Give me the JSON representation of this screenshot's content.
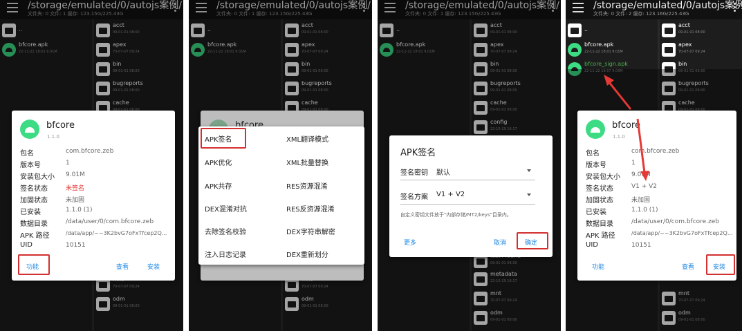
{
  "topbar": {
    "path": "/storage/emulated/0/autojs案例/",
    "sub_a": "文件夹: 0  文件: 1  缓存: 123.15G/225.43G",
    "sub_b": "文件夹: 0  文件: 2  缓存: 123.16G/225.43G"
  },
  "left_files": {
    "up": "..",
    "apk_name": "bfcore.apk",
    "apk_meta": "22-11-22 18:01  9.01M",
    "signed_name": "bfcore_sign.apk",
    "signed_meta": "22-11-22 18:07  9.09M"
  },
  "right_files": [
    {
      "name": "acct",
      "date": "09-01-01 08:00"
    },
    {
      "name": "apex",
      "date": "70-07-07 09:24"
    },
    {
      "name": "bin",
      "date": "09-01-01 08:00"
    },
    {
      "name": "bugreports",
      "date": "09-01-01 08:00"
    },
    {
      "name": "cache",
      "date": "09-01-01 08:00"
    },
    {
      "name": "config",
      "date": "22-10-29 16:17"
    }
  ],
  "right_files_bottom": [
    {
      "name": "lost+found",
      "date": "09-01-01 08:00"
    },
    {
      "name": "metadata",
      "date": "22-10-29 16:17"
    },
    {
      "name": "mnt",
      "date": "70-07-07 09:24"
    },
    {
      "name": "odm",
      "date": "09-01-01 08:00"
    }
  ],
  "app_info": {
    "name": "bfcore",
    "version": "1.1.0",
    "rows": [
      {
        "k": "包名",
        "v": "com.bfcore.zeb"
      },
      {
        "k": "版本号",
        "v": "1"
      },
      {
        "k": "安装包大小",
        "v": "9.01M"
      },
      {
        "k": "签名状态",
        "v": "未签名"
      },
      {
        "k": "加固状态",
        "v": "未加固"
      },
      {
        "k": "已安装",
        "v": "1.1.0 (1)"
      },
      {
        "k": "数据目录",
        "v": "/data/user/0/com.bfcore.zeb"
      },
      {
        "k": "APK 路径",
        "v": "/data/app/~~3K2bvG7oFxTfcep2Q..."
      },
      {
        "k": "UID",
        "v": "10151"
      }
    ],
    "signed_v": "V1 + V2",
    "size_v4": "9.09M",
    "btn_func": "功能",
    "btn_view": "查看",
    "btn_install": "安装"
  },
  "menu": {
    "left": [
      "APK签名",
      "APK优化",
      "APK共存",
      "DEX混淆对抗",
      "去除签名校验",
      "注入日志记录"
    ],
    "right": [
      "XML翻译模式",
      "XML批量替换",
      "RES资源混淆",
      "RES反资源混淆",
      "DEX字符串解密",
      "DEX重新划分"
    ]
  },
  "sign_dialog": {
    "title": "APK签名",
    "key_label": "签名密钥",
    "key_value": "默认",
    "scheme_label": "签名方案",
    "scheme_value": "V1 + V2",
    "hint": "自定义密钥文件放于\"内部存储/MT2/keys\"目录内。",
    "more": "更多",
    "cancel": "取消",
    "ok": "确定"
  },
  "colors": {
    "accent": "#1e88e5",
    "highlight": "#d32f2f",
    "android": "#3ddc84"
  }
}
